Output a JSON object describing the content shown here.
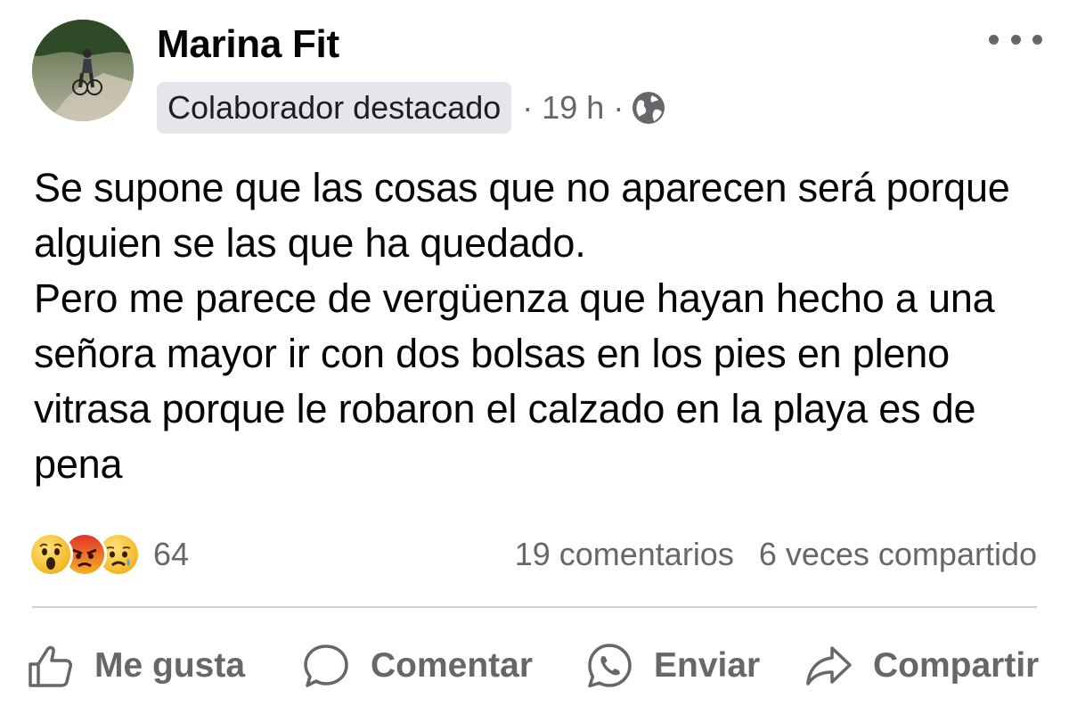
{
  "post": {
    "author": "Marina Fit",
    "badge": "Colaborador destacado",
    "time": "· 19 h ·",
    "privacy_icon": "globe-icon",
    "paragraphs": [
      "Se supone que las cosas que no aparecen será porque alguien se las que ha quedado.",
      "Pero me parece de vergüenza que hayan hecho a una señora mayor ir con dos bolsas en los pies en pleno vitrasa porque le robaron el calzado en la playa es de pena"
    ]
  },
  "stats": {
    "reaction_icons": [
      "wow-emoji-icon",
      "angry-emoji-icon",
      "sad-emoji-icon"
    ],
    "reaction_count": "64",
    "comments": "19 comentarios",
    "shares": "6 veces compartido"
  },
  "actions": {
    "like": "Me gusta",
    "comment": "Comentar",
    "send": "Enviar",
    "share": "Compartir"
  },
  "colors": {
    "text": "#050505",
    "secondary": "#65676b",
    "badge_bg": "#e4e6eb",
    "divider": "#ced0d4"
  }
}
